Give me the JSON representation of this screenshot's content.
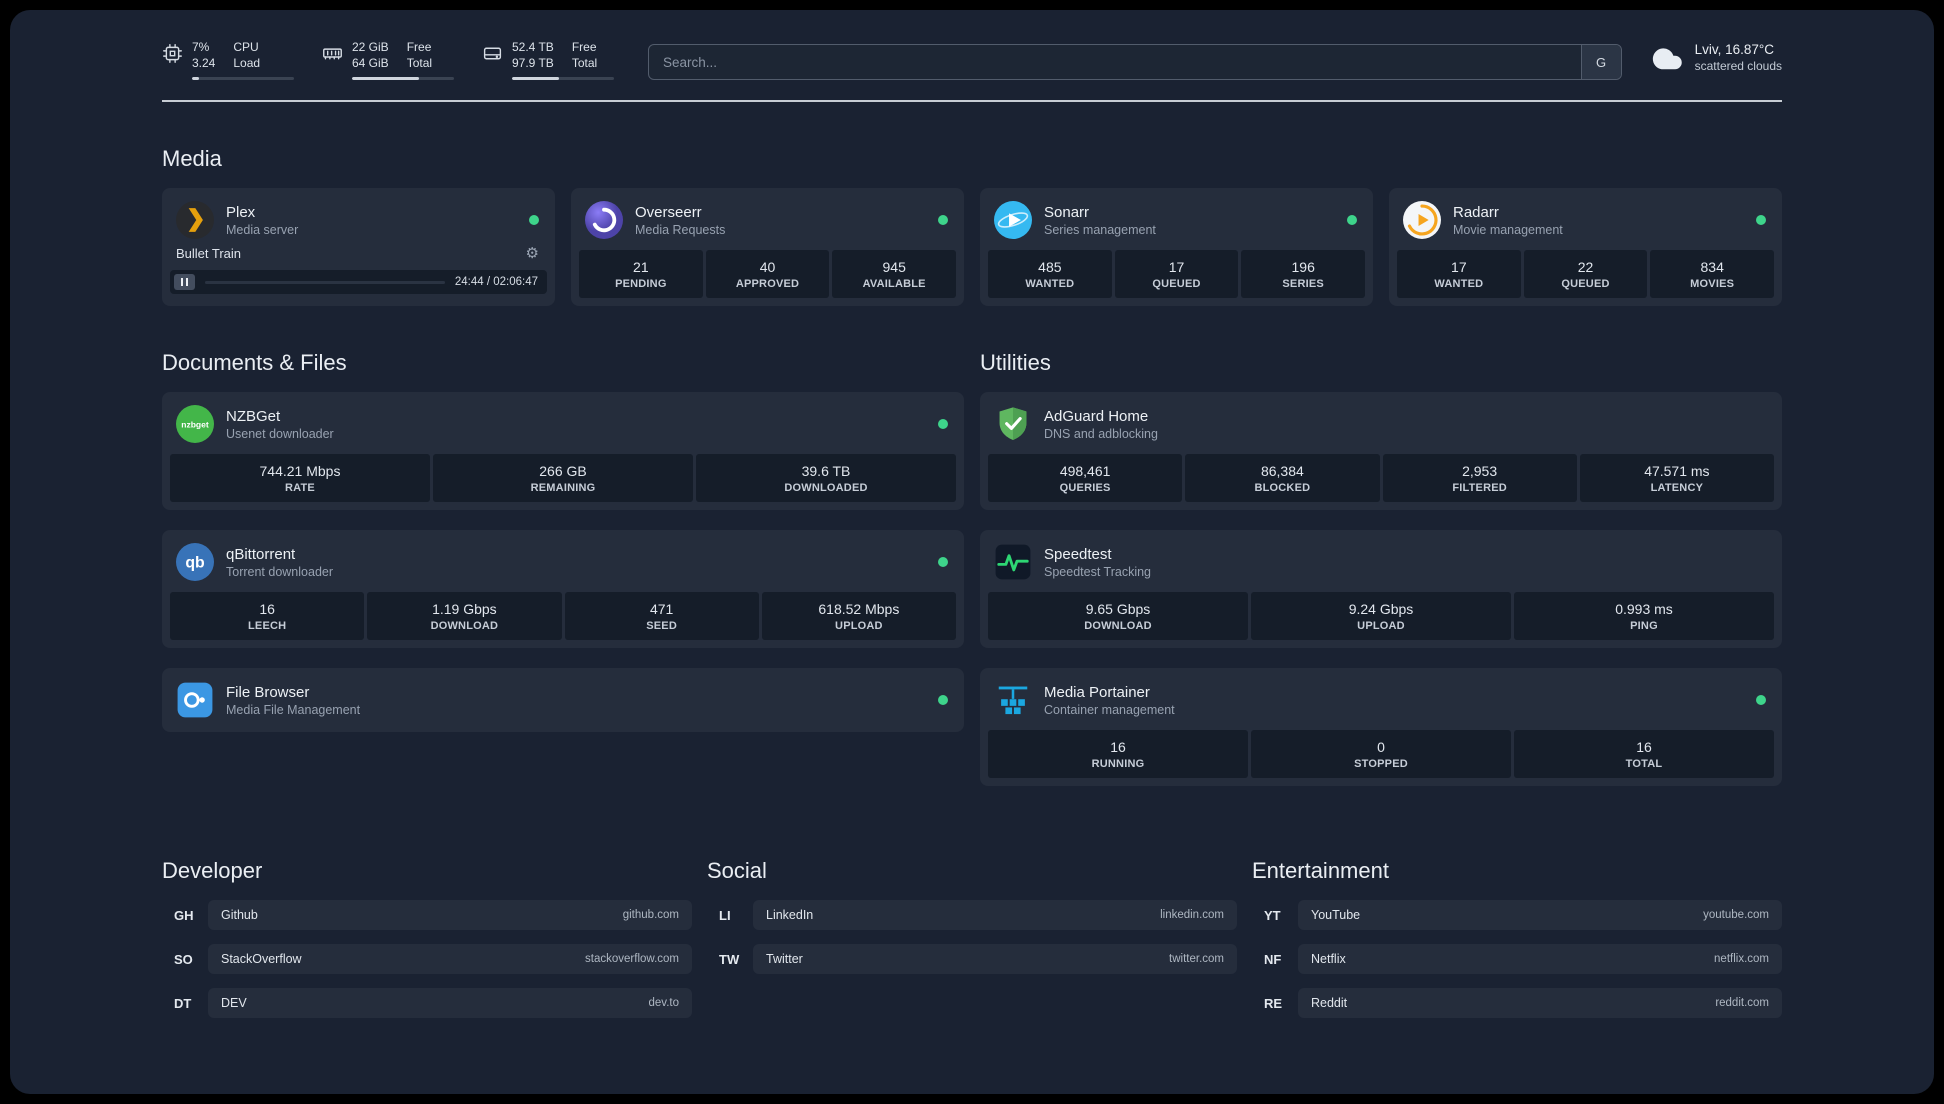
{
  "header": {
    "cpu": {
      "value_top": "7%",
      "value_bottom": "3.24",
      "label_top": "CPU",
      "label_bottom": "Load",
      "progress_style": "width:7%"
    },
    "memory": {
      "value_top": "22 GiB",
      "value_bottom": "64 GiB",
      "label_top": "Free",
      "label_bottom": "Total",
      "progress_style": "width:66%"
    },
    "disk": {
      "value_top": "52.4 TB",
      "value_bottom": "97.9 TB",
      "label_top": "Free",
      "label_bottom": "Total",
      "progress_style": "width:46%"
    },
    "search": {
      "placeholder": "Search...",
      "button_label": "G"
    },
    "weather": {
      "location": "Lviv, 16.87°C",
      "condition": "scattered clouds"
    }
  },
  "sections": {
    "media": "Media",
    "documents": "Documents & Files",
    "utilities": "Utilities",
    "developer": "Developer",
    "social": "Social",
    "entertainment": "Entertainment"
  },
  "services": {
    "plex": {
      "name": "Plex",
      "subtitle": "Media server",
      "now_playing": "Bullet Train",
      "time": "24:44 / 02:06:47",
      "seek_style": "width:19.5%"
    },
    "overseerr": {
      "name": "Overseerr",
      "subtitle": "Media Requests",
      "stats": [
        {
          "value": "21",
          "label": "PENDING"
        },
        {
          "value": "40",
          "label": "APPROVED"
        },
        {
          "value": "945",
          "label": "AVAILABLE"
        }
      ]
    },
    "sonarr": {
      "name": "Sonarr",
      "subtitle": "Series management",
      "stats": [
        {
          "value": "485",
          "label": "WANTED"
        },
        {
          "value": "17",
          "label": "QUEUED"
        },
        {
          "value": "196",
          "label": "SERIES"
        }
      ]
    },
    "radarr": {
      "name": "Radarr",
      "subtitle": "Movie management",
      "stats": [
        {
          "value": "17",
          "label": "WANTED"
        },
        {
          "value": "22",
          "label": "QUEUED"
        },
        {
          "value": "834",
          "label": "MOVIES"
        }
      ]
    },
    "nzbget": {
      "name": "NZBGet",
      "subtitle": "Usenet downloader",
      "icon_text": "nzbget",
      "stats": [
        {
          "value": "744.21 Mbps",
          "label": "RATE"
        },
        {
          "value": "266 GB",
          "label": "REMAINING"
        },
        {
          "value": "39.6 TB",
          "label": "DOWNLOADED"
        }
      ]
    },
    "qbittorrent": {
      "name": "qBittorrent",
      "subtitle": "Torrent downloader",
      "icon_text": "qb",
      "stats": [
        {
          "value": "16",
          "label": "LEECH"
        },
        {
          "value": "1.19 Gbps",
          "label": "DOWNLOAD"
        },
        {
          "value": "471",
          "label": "SEED"
        },
        {
          "value": "618.52 Mbps",
          "label": "UPLOAD"
        }
      ]
    },
    "filebrowser": {
      "name": "File Browser",
      "subtitle": "Media File Management"
    },
    "adguard": {
      "name": "AdGuard Home",
      "subtitle": "DNS and adblocking",
      "stats": [
        {
          "value": "498,461",
          "label": "QUERIES"
        },
        {
          "value": "86,384",
          "label": "BLOCKED"
        },
        {
          "value": "2,953",
          "label": "FILTERED"
        },
        {
          "value": "47.571 ms",
          "label": "LATENCY"
        }
      ]
    },
    "speedtest": {
      "name": "Speedtest",
      "subtitle": "Speedtest Tracking",
      "stats": [
        {
          "value": "9.65 Gbps",
          "label": "DOWNLOAD"
        },
        {
          "value": "9.24 Gbps",
          "label": "UPLOAD"
        },
        {
          "value": "0.993 ms",
          "label": "PING"
        }
      ]
    },
    "portainer": {
      "name": "Media Portainer",
      "subtitle": "Container management",
      "stats": [
        {
          "value": "16",
          "label": "RUNNING"
        },
        {
          "value": "0",
          "label": "STOPPED"
        },
        {
          "value": "16",
          "label": "TOTAL"
        }
      ]
    }
  },
  "bookmarks": {
    "developer": [
      {
        "abbr": "GH",
        "name": "Github",
        "domain": "github.com"
      },
      {
        "abbr": "SO",
        "name": "StackOverflow",
        "domain": "stackoverflow.com"
      },
      {
        "abbr": "DT",
        "name": "DEV",
        "domain": "dev.to"
      }
    ],
    "social": [
      {
        "abbr": "LI",
        "name": "LinkedIn",
        "domain": "linkedin.com"
      },
      {
        "abbr": "TW",
        "name": "Twitter",
        "domain": "twitter.com"
      }
    ],
    "entertainment": [
      {
        "abbr": "YT",
        "name": "YouTube",
        "domain": "youtube.com"
      },
      {
        "abbr": "NF",
        "name": "Netflix",
        "domain": "netflix.com"
      },
      {
        "abbr": "RE",
        "name": "Reddit",
        "domain": "reddit.com"
      }
    ]
  },
  "colors": {
    "status_online": "#3ed48b",
    "panel_background": "#1a2232",
    "plex_amber": "#e5a00d"
  }
}
